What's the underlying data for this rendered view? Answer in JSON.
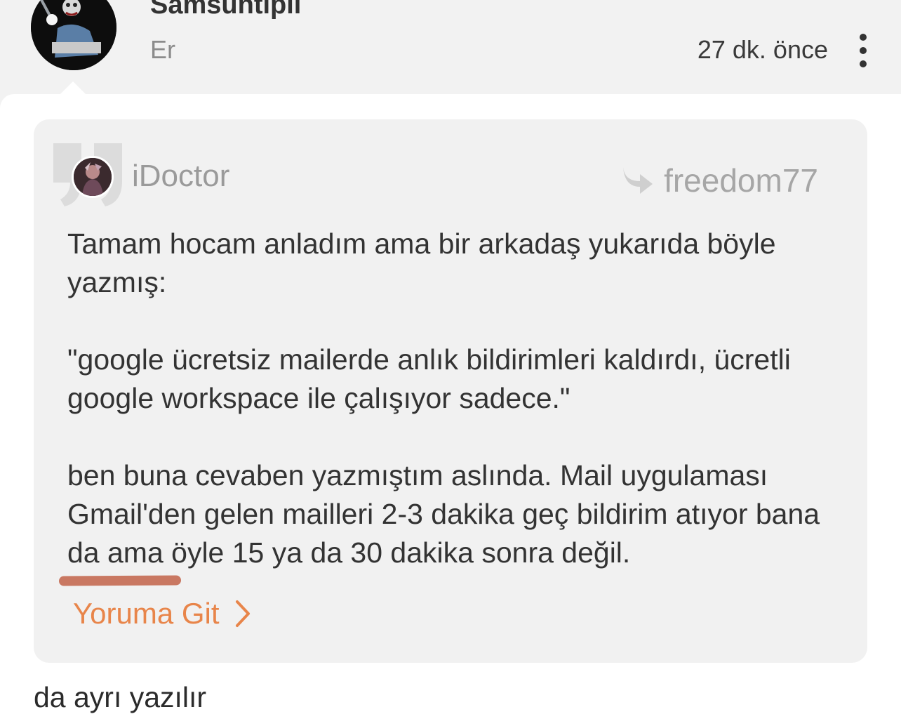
{
  "post": {
    "author": "Samsuntıplı",
    "gender": "Er",
    "timestamp": "27 dk. önce",
    "body": "da ayrı yazılır"
  },
  "quote": {
    "author": "iDoctor",
    "reply_to": "freedom77",
    "paragraphs": [
      "Tamam hocam anladım ama bir arkadaş yukarıda böyle yazmış:",
      "\"google ücretsiz mailerde anlık bildirimleri kaldırdı, ücretli google workspace ile çalışıyor sadece.\"",
      "ben buna cevaben yazmıştım aslında. Mail uygulaması Gmail'den gelen mailleri 2-3 dakika geç bildirim atıyor bana da ama öyle 15 ya da 30 dakika sonra değil."
    ],
    "goto_label": "Yoruma Git"
  },
  "icons": {
    "more": "more-vertical-icon",
    "quote": "quote-mark-icon",
    "reply": "reply-arrow-icon",
    "chevron": "chevron-right-icon"
  },
  "colors": {
    "accent": "#e8854a",
    "highlight": "#c46a52",
    "quote_background": "#f1f1f1",
    "header_background": "#f2f2f2"
  }
}
